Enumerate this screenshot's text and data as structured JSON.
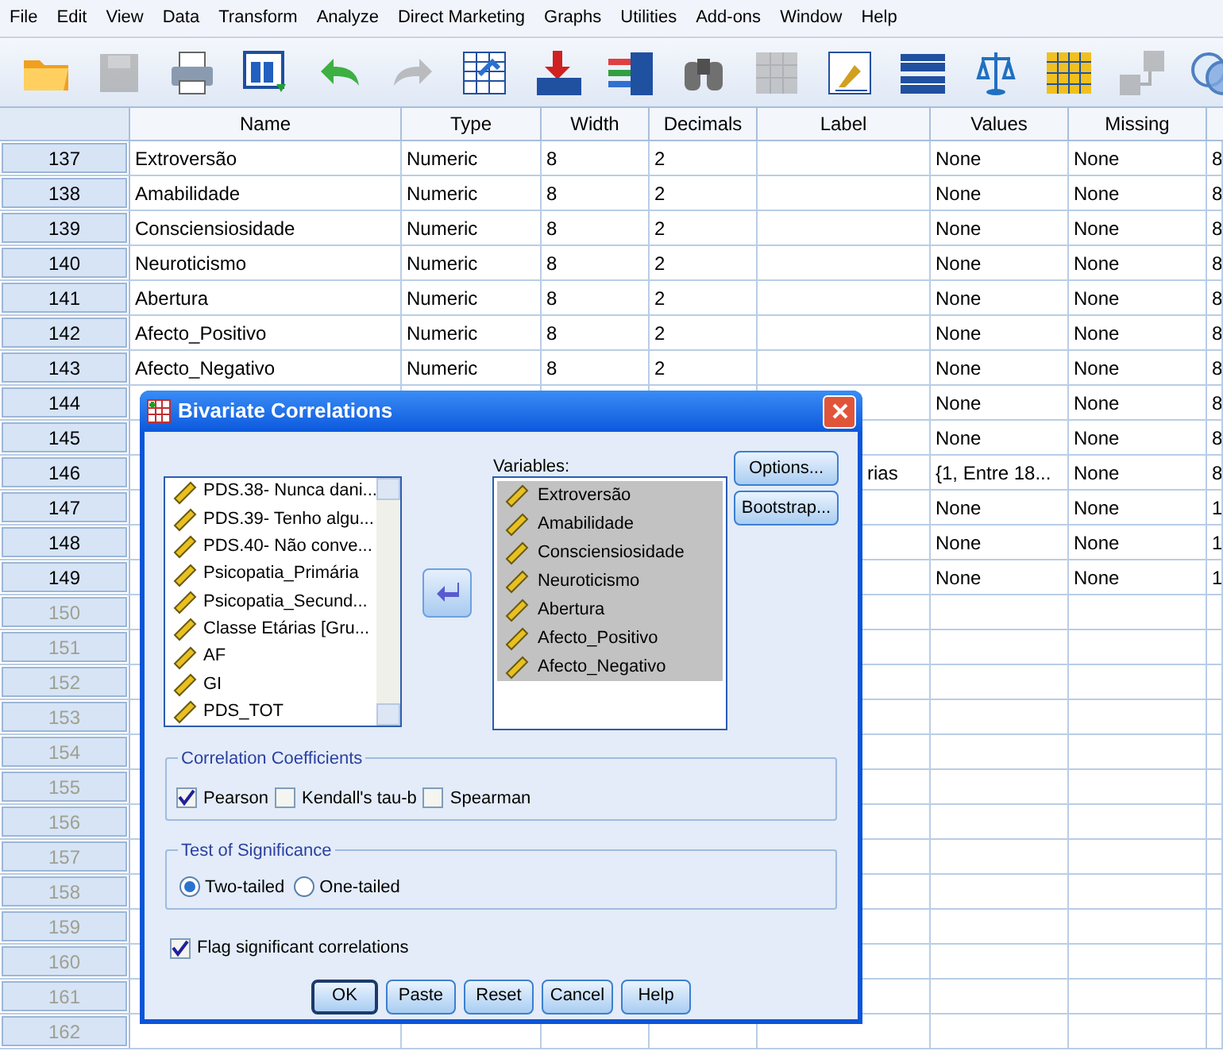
{
  "menu": [
    "File",
    "Edit",
    "View",
    "Data",
    "Transform",
    "Analyze",
    "Direct Marketing",
    "Graphs",
    "Utilities",
    "Add-ons",
    "Window",
    "Help"
  ],
  "toolbar": [
    {
      "kind": "open",
      "disabled": false
    },
    {
      "kind": "save",
      "disabled": true
    },
    {
      "kind": "print",
      "disabled": false
    },
    {
      "kind": "recall",
      "disabled": false
    },
    {
      "kind": "undo",
      "disabled": false
    },
    {
      "kind": "redo",
      "disabled": true
    },
    {
      "kind": "goto-case",
      "disabled": false
    },
    {
      "kind": "goto-variable",
      "disabled": false
    },
    {
      "kind": "variables",
      "disabled": false
    },
    {
      "kind": "find",
      "disabled": false
    },
    {
      "kind": "insert-cases",
      "disabled": true
    },
    {
      "kind": "split",
      "disabled": false
    },
    {
      "kind": "table",
      "disabled": false
    },
    {
      "kind": "weight",
      "disabled": false
    },
    {
      "kind": "sets",
      "disabled": false
    },
    {
      "kind": "labels",
      "disabled": true
    },
    {
      "kind": "circles",
      "disabled": false
    }
  ],
  "table": {
    "columns": [
      "Name",
      "Type",
      "Width",
      "Decimals",
      "Label",
      "Values",
      "Missing"
    ],
    "rows": [
      {
        "number": "137",
        "empty": false,
        "cells": [
          "Extroversão",
          "Numeric",
          "8",
          "2",
          "",
          "None",
          "None",
          "8"
        ]
      },
      {
        "number": "138",
        "empty": false,
        "cells": [
          "Amabilidade",
          "Numeric",
          "8",
          "2",
          "",
          "None",
          "None",
          "8"
        ]
      },
      {
        "number": "139",
        "empty": false,
        "cells": [
          "Consciensiosidade",
          "Numeric",
          "8",
          "2",
          "",
          "None",
          "None",
          "8"
        ]
      },
      {
        "number": "140",
        "empty": false,
        "cells": [
          "Neuroticismo",
          "Numeric",
          "8",
          "2",
          "",
          "None",
          "None",
          "8"
        ]
      },
      {
        "number": "141",
        "empty": false,
        "cells": [
          "Abertura",
          "Numeric",
          "8",
          "2",
          "",
          "None",
          "None",
          "8"
        ]
      },
      {
        "number": "142",
        "empty": false,
        "cells": [
          "Afecto_Positivo",
          "Numeric",
          "8",
          "2",
          "",
          "None",
          "None",
          "8"
        ]
      },
      {
        "number": "143",
        "empty": false,
        "cells": [
          "Afecto_Negativo",
          "Numeric",
          "8",
          "2",
          "",
          "None",
          "None",
          "8"
        ]
      },
      {
        "number": "144",
        "empty": false,
        "cells": [
          "",
          "",
          "",
          "",
          "",
          "None",
          "None",
          "8"
        ]
      },
      {
        "number": "145",
        "empty": false,
        "cells": [
          "",
          "",
          "",
          "",
          "",
          "None",
          "None",
          "8"
        ]
      },
      {
        "number": "146",
        "empty": false,
        "cells": [
          "",
          "",
          "",
          "",
          "rias",
          "{1, Entre 18...",
          "None",
          "8"
        ]
      },
      {
        "number": "147",
        "empty": false,
        "cells": [
          "",
          "",
          "",
          "",
          "",
          "None",
          "None",
          "1"
        ]
      },
      {
        "number": "148",
        "empty": false,
        "cells": [
          "",
          "",
          "",
          "",
          "",
          "None",
          "None",
          "1"
        ]
      },
      {
        "number": "149",
        "empty": false,
        "cells": [
          "",
          "",
          "",
          "",
          "",
          "None",
          "None",
          "1"
        ]
      },
      {
        "number": "150",
        "empty": true,
        "cells": []
      },
      {
        "number": "151",
        "empty": true,
        "cells": []
      },
      {
        "number": "152",
        "empty": true,
        "cells": []
      },
      {
        "number": "153",
        "empty": true,
        "cells": []
      },
      {
        "number": "154",
        "empty": true,
        "cells": []
      },
      {
        "number": "155",
        "empty": true,
        "cells": []
      },
      {
        "number": "156",
        "empty": true,
        "cells": []
      },
      {
        "number": "157",
        "empty": true,
        "cells": []
      },
      {
        "number": "158",
        "empty": true,
        "cells": []
      },
      {
        "number": "159",
        "empty": true,
        "cells": []
      },
      {
        "number": "160",
        "empty": true,
        "cells": []
      },
      {
        "number": "161",
        "empty": true,
        "cells": []
      },
      {
        "number": "162",
        "empty": true,
        "cells": []
      }
    ]
  },
  "dialog": {
    "title": "Bivariate Correlations",
    "source": [
      "PDS.38- Nunca dani...",
      "PDS.39- Tenho algu...",
      "PDS.40- Não conve...",
      "Psicopatia_Primária",
      "Psicopatia_Secund...",
      "Classe Etárias [Gru...",
      "AF",
      "GI",
      "PDS_TOT"
    ],
    "variables_label": "Variables:",
    "variables": [
      {
        "label": "Extroversão",
        "selected": true
      },
      {
        "label": "Amabilidade",
        "selected": true
      },
      {
        "label": "Consciensiosidade",
        "selected": true
      },
      {
        "label": "Neuroticismo",
        "selected": true
      },
      {
        "label": "Abertura",
        "selected": true
      },
      {
        "label": "Afecto_Positivo",
        "selected": true
      },
      {
        "label": "Afecto_Negativo",
        "selected": true
      }
    ],
    "side_buttons": [
      "Options...",
      "Bootstrap..."
    ],
    "coefficients": {
      "title": "Correlation Coefficients",
      "options": [
        {
          "label": "Pearson",
          "checked": true
        },
        {
          "label": "Kendall's tau-b",
          "checked": false
        },
        {
          "label": "Spearman",
          "checked": false
        }
      ]
    },
    "significance": {
      "title": "Test of Significance",
      "options": [
        {
          "label": "Two-tailed",
          "selected": true
        },
        {
          "label": "One-tailed",
          "selected": false
        }
      ]
    },
    "flag": {
      "label": "Flag significant correlations",
      "checked": true
    },
    "buttons": [
      "OK",
      "Paste",
      "Reset",
      "Cancel",
      "Help"
    ]
  }
}
